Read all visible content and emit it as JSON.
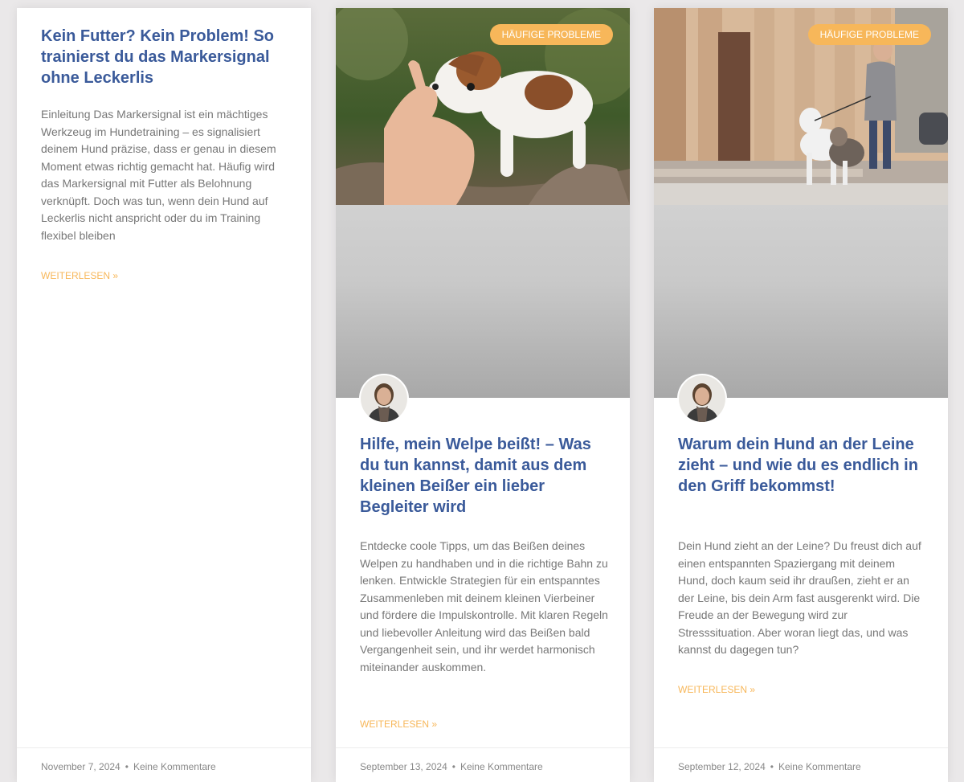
{
  "cards": [
    {
      "title": "Kein Futter? Kein Problem! So trainierst du das Markersignal ohne Leckerlis",
      "excerpt": "Einleitung Das Markersignal ist ein mächtiges Werkzeug im Hundetraining – es signalisiert deinem Hund präzise, dass er genau in diesem Moment etwas richtig gemacht hat. Häufig wird das Markersignal mit Futter als Belohnung verknüpft. Doch was tun, wenn dein Hund auf Leckerlis nicht anspricht oder du im Training flexibel bleiben",
      "read_more": "Weiterlesen »",
      "date": "November 7, 2024",
      "separator": "•",
      "comments": "Keine Kommentare"
    },
    {
      "badge": "Häufige Probleme",
      "title": "Hilfe, mein Welpe beißt! – Was du tun kannst, damit aus dem kleinen Beißer ein lieber Begleiter wird",
      "excerpt": "Entdecke coole Tipps, um das Beißen deines Welpen zu handhaben und in die richtige Bahn zu lenken. Entwickle Strategien für ein entspanntes Zusammenleben mit deinem kleinen Vierbeiner und fördere die Impulskontrolle. Mit klaren Regeln und liebevoller Anleitung wird das Beißen bald Vergangenheit sein, und ihr werdet harmonisch miteinander auskommen.",
      "read_more": "Weiterlesen »",
      "date": "September 13, 2024",
      "separator": "•",
      "comments": "Keine Kommentare"
    },
    {
      "badge": "Häufige Probleme",
      "title": "Warum dein Hund an der Leine zieht – und wie du es endlich in den Griff bekommst!",
      "excerpt": "Dein Hund zieht an der Leine? Du freust dich auf einen entspannten Spaziergang mit deinem Hund, doch kaum seid ihr draußen, zieht er an der Leine, bis dein Arm fast ausgerenkt wird. Die Freude an der Bewegung wird zur Stresssituation. Aber woran liegt das, und was kannst du dagegen tun?",
      "read_more": "Weiterlesen »",
      "date": "September 12, 2024",
      "separator": "•",
      "comments": "Keine Kommentare"
    }
  ],
  "colors": {
    "title": "#3a5a9a",
    "accent": "#f7b75a",
    "text": "#777777",
    "meta": "#888888",
    "background": "#eae8e9"
  }
}
